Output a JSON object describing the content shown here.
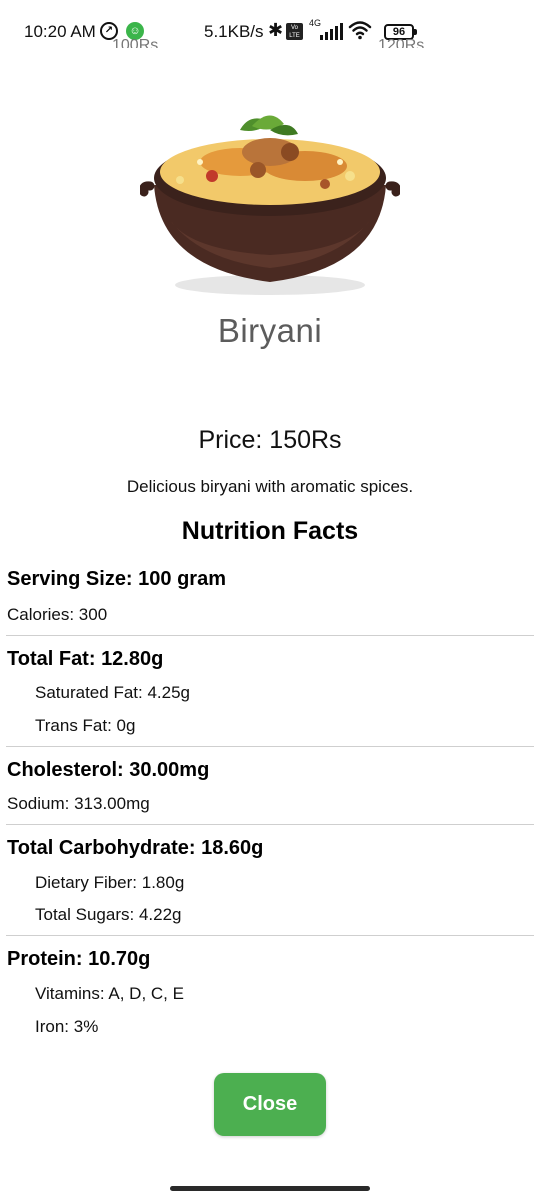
{
  "status_bar": {
    "time": "10:20 AM",
    "speed": "5.1KB/s",
    "network": "4G",
    "volte": "Vo LTE",
    "battery": "96",
    "ghost_left": "100Rs",
    "ghost_right": "120Rs"
  },
  "item": {
    "title": "Biryani",
    "price": "Price: 150Rs",
    "description": "Delicious biryani with aromatic spices."
  },
  "nutrition": {
    "heading": "Nutrition Facts",
    "serving_size": "Serving Size: 100 gram",
    "calories": "Calories: 300",
    "total_fat": "Total Fat: 12.80g",
    "saturated_fat": "Saturated Fat: 4.25g",
    "trans_fat": "Trans Fat: 0g",
    "cholesterol": "Cholesterol: 30.00mg",
    "sodium": "Sodium: 313.00mg",
    "total_carbohydrate": "Total Carbohydrate: 18.60g",
    "dietary_fiber": "Dietary Fiber: 1.80g",
    "total_sugars": "Total Sugars: 4.22g",
    "protein": "Protein: 10.70g",
    "vitamins": "Vitamins: A, D, C, E",
    "iron": "Iron: 3%"
  },
  "actions": {
    "close_label": "Close"
  },
  "colors": {
    "accent": "#4caf50",
    "divider": "#cfcfcf"
  }
}
